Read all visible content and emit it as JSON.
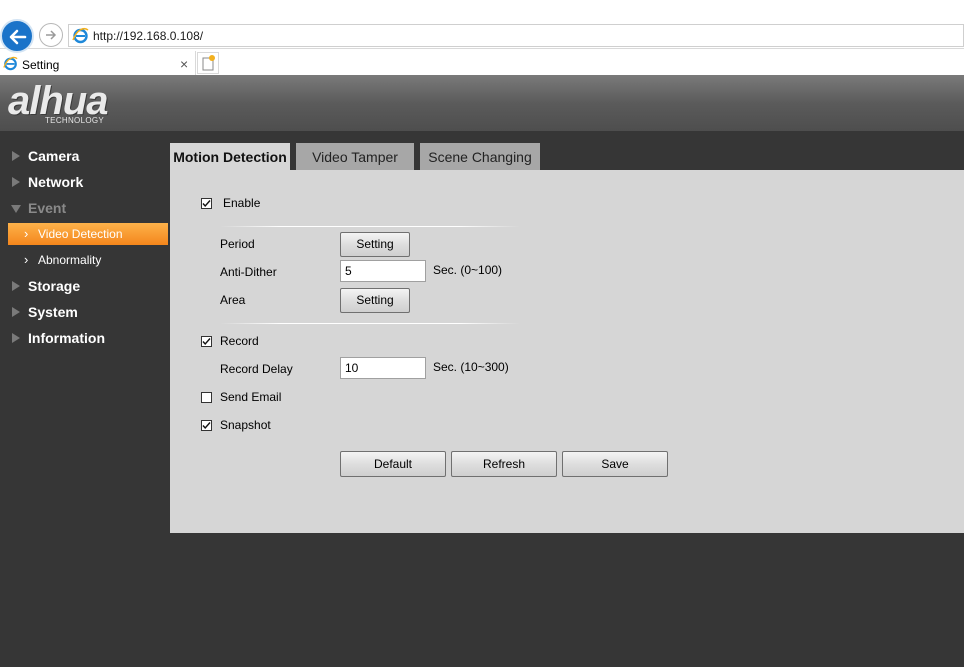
{
  "browser": {
    "url": "http://192.168.0.108/",
    "tab_title": "Setting",
    "tab_close": "×"
  },
  "brand": {
    "logo": "alhua",
    "tagline": "TECHNOLOGY"
  },
  "sidebar": {
    "items": [
      {
        "label": "Camera"
      },
      {
        "label": "Network"
      },
      {
        "label": "Event"
      },
      {
        "label": "Video Detection"
      },
      {
        "label": "Abnormality"
      },
      {
        "label": "Storage"
      },
      {
        "label": "System"
      },
      {
        "label": "Information"
      }
    ],
    "active": "Video Detection"
  },
  "tabs": [
    {
      "label": "Motion Detection",
      "active": true
    },
    {
      "label": "Video Tamper",
      "active": false
    },
    {
      "label": "Scene Changing",
      "active": false
    }
  ],
  "form": {
    "enable": {
      "label": "Enable",
      "checked": true
    },
    "period": {
      "label": "Period",
      "button": "Setting"
    },
    "anti_dither": {
      "label": "Anti-Dither",
      "value": "5",
      "unit": "Sec. (0~100)"
    },
    "area": {
      "label": "Area",
      "button": "Setting"
    },
    "record": {
      "label": "Record",
      "checked": true
    },
    "record_delay": {
      "label": "Record Delay",
      "value": "10",
      "unit": "Sec. (10~300)"
    },
    "send_email": {
      "label": "Send Email",
      "checked": false
    },
    "snapshot": {
      "label": "Snapshot",
      "checked": true
    }
  },
  "actions": {
    "default": "Default",
    "refresh": "Refresh",
    "save": "Save"
  },
  "colors": {
    "accent": "#f4861c",
    "background": "#363636",
    "panel": "#d6d6d6"
  }
}
